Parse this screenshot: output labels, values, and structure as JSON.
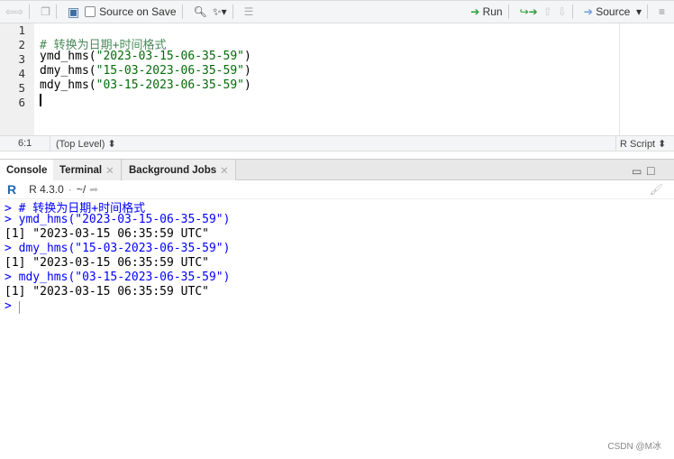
{
  "toolbar": {
    "source_on_save": "Source on Save",
    "run": "Run",
    "source": "Source"
  },
  "editor": {
    "line_numbers": [
      "1",
      "2",
      "3",
      "4",
      "5",
      "6"
    ],
    "lines": [
      {
        "comment": "# 转换为日期+时间格式"
      },
      {
        "fn": "ymd_hms(",
        "str": "\"2023-03-15-06-35-59\"",
        "end": ")"
      },
      {
        "fn": "dmy_hms(",
        "str": "\"15-03-2023-06-35-59\"",
        "end": ")"
      },
      {
        "fn": "mdy_hms(",
        "str": "\"03-15-2023-06-35-59\"",
        "end": ")"
      }
    ]
  },
  "status": {
    "position": "6:1",
    "scope": "(Top Level)",
    "filetype": "R Script"
  },
  "tabs": [
    {
      "label": "Console"
    },
    {
      "label": "Terminal"
    },
    {
      "label": "Background Jobs"
    }
  ],
  "console": {
    "version": "R 4.3.0",
    "path": "~/",
    "lines": [
      {
        "type": "cmd",
        "text": "> # 转换为日期+时间格式"
      },
      {
        "type": "cmd",
        "text": "> ymd_hms(\"2023-03-15-06-35-59\")"
      },
      {
        "type": "out",
        "text": "[1] \"2023-03-15 06:35:59 UTC\""
      },
      {
        "type": "cmd",
        "text": "> dmy_hms(\"15-03-2023-06-35-59\")"
      },
      {
        "type": "out",
        "text": "[1] \"2023-03-15 06:35:59 UTC\""
      },
      {
        "type": "cmd",
        "text": "> mdy_hms(\"03-15-2023-06-35-59\")"
      },
      {
        "type": "out",
        "text": "[1] \"2023-03-15 06:35:59 UTC\""
      },
      {
        "type": "cmd",
        "text": "> "
      }
    ]
  },
  "watermark": "CSDN @M冰"
}
